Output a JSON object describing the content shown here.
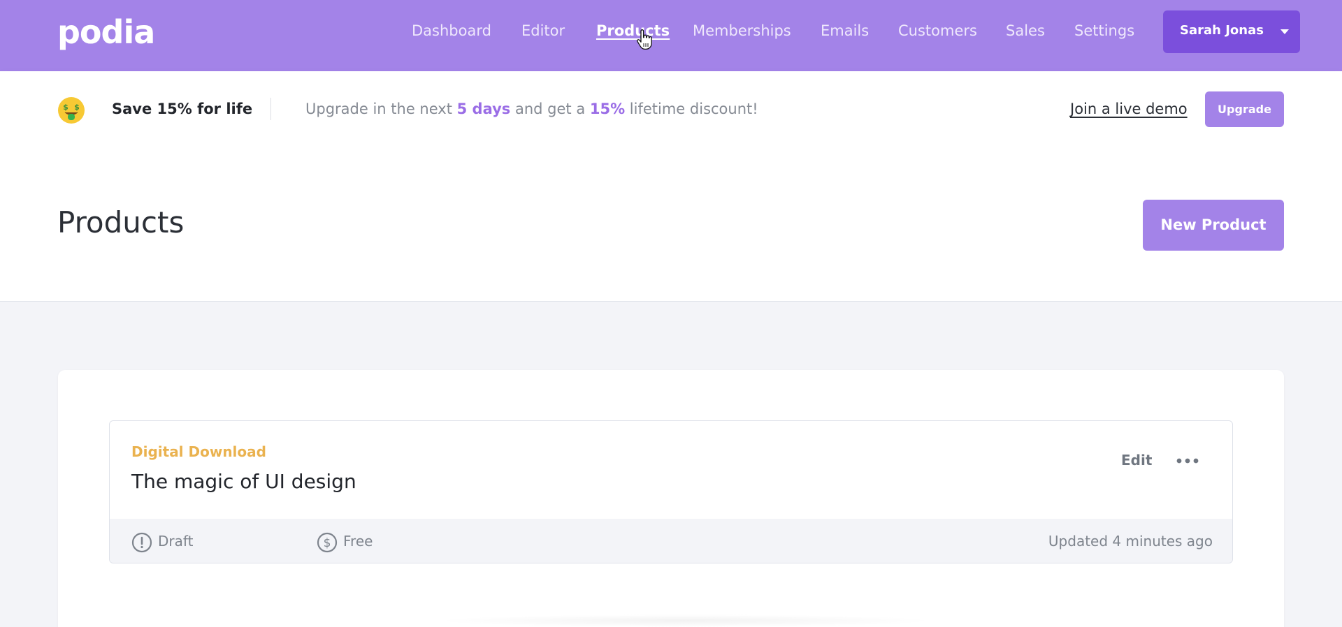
{
  "app": {
    "logo": "podia"
  },
  "nav": {
    "items": [
      {
        "label": "Dashboard"
      },
      {
        "label": "Editor"
      },
      {
        "label": "Products"
      },
      {
        "label": "Memberships"
      },
      {
        "label": "Emails"
      },
      {
        "label": "Customers"
      },
      {
        "label": "Sales"
      },
      {
        "label": "Settings"
      }
    ],
    "active": "Products",
    "user": {
      "name": "Sarah Jonas"
    }
  },
  "promo": {
    "emoji": "money-mouth-face-icon",
    "title": "Save 15% for life",
    "text_before": "Upgrade in the next ",
    "days": "5 days",
    "text_middle": " and get a ",
    "discount": "15%",
    "text_after": " lifetime discount!",
    "demo_link": "Join a live demo",
    "upgrade_label": "Upgrade"
  },
  "header": {
    "title": "Products",
    "new_product_label": "New Product"
  },
  "products": [
    {
      "type": "Digital Download",
      "title": "The magic of UI design",
      "edit_label": "Edit",
      "status": "Draft",
      "price": "Free",
      "updated": "Updated 4 minutes ago"
    }
  ],
  "colors": {
    "brand": "#a383e8",
    "brand_dark": "#7b4fdc",
    "accent_type": "#eab24f",
    "highlight": "#9a6de6"
  }
}
